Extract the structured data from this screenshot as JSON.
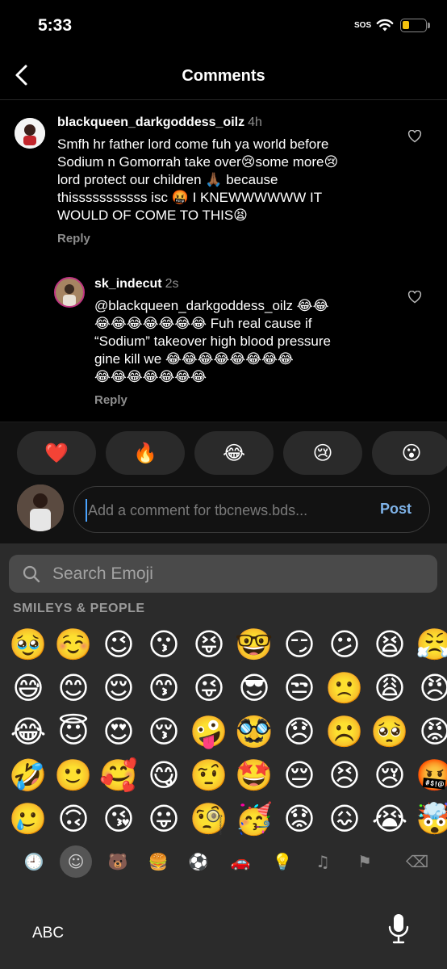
{
  "status": {
    "time": "5:33",
    "sos": "SOS",
    "battery_level": 0.3,
    "battery_color": "#f4c20d"
  },
  "nav": {
    "title": "Comments"
  },
  "comments": [
    {
      "user": "blackqueen_darkgoddess_oilz",
      "time": "4h",
      "lines": [
        "Smfh hr father lord come fuh ya world before",
        "Sodium n Gomorrah take over😢some more😢",
        "lord protect our children 🙏🏾 because",
        "thisssssssssss isc 🤬 I KNEWWWWWW IT",
        "WOULD OF COME TO THIS😫"
      ],
      "reply_label": "Reply"
    },
    {
      "user": "sk_indecut",
      "time": "2s",
      "lines": [
        "@blackqueen_darkgoddess_oilz 😂😂",
        "😂😂😂😂😂😂😂 Fuh real cause if",
        "“Sodium” takeover high blood pressure",
        "gine kill we 😂😂😂😂😂😂😂😂",
        "😂😂😂😂😂😂😂"
      ],
      "reply_label": "Reply"
    }
  ],
  "quick_reactions": [
    "❤️",
    "🔥",
    "😂",
    "😢",
    "😮"
  ],
  "composer": {
    "placeholder": "Add a comment for tbcnews.bds...",
    "post_label": "Post",
    "accent": "#7fb3e8"
  },
  "keyboard": {
    "search_placeholder": "Search Emoji",
    "category_label": "SMILEYS & PEOPLE",
    "emoji_rows": [
      [
        "🥹",
        "☺️",
        "😉",
        "😗",
        "😝",
        "🤓",
        "😏",
        "😕",
        "😫",
        "😤"
      ],
      [
        "😅",
        "😊",
        "😌",
        "😙",
        "😜",
        "😎",
        "😒",
        "🙁",
        "😩",
        "😠"
      ],
      [
        "😂",
        "😇",
        "😍",
        "😚",
        "🤪",
        "🥸",
        "😞",
        "☹️",
        "🥺",
        "😡"
      ],
      [
        "🤣",
        "🙂",
        "🥰",
        "😋",
        "🤨",
        "🤩",
        "😔",
        "😣",
        "😢",
        "🤬"
      ],
      [
        "🥲",
        "🙃",
        "😘",
        "😛",
        "🧐",
        "🥳",
        "😟",
        "😖",
        "😭",
        "🤯"
      ]
    ],
    "categories": [
      {
        "name": "recent-icon",
        "glyph": "🕘"
      },
      {
        "name": "smileys-icon",
        "glyph": "☺"
      },
      {
        "name": "animals-icon",
        "glyph": "🐻"
      },
      {
        "name": "food-icon",
        "glyph": "🍔"
      },
      {
        "name": "activity-icon",
        "glyph": "⚽"
      },
      {
        "name": "travel-icon",
        "glyph": "🚗"
      },
      {
        "name": "objects-icon",
        "glyph": "💡"
      },
      {
        "name": "symbols-icon",
        "glyph": "♫"
      },
      {
        "name": "flags-icon",
        "glyph": "⚑"
      },
      {
        "name": "backspace-icon",
        "glyph": "⌫"
      }
    ],
    "abc_label": "ABC"
  }
}
